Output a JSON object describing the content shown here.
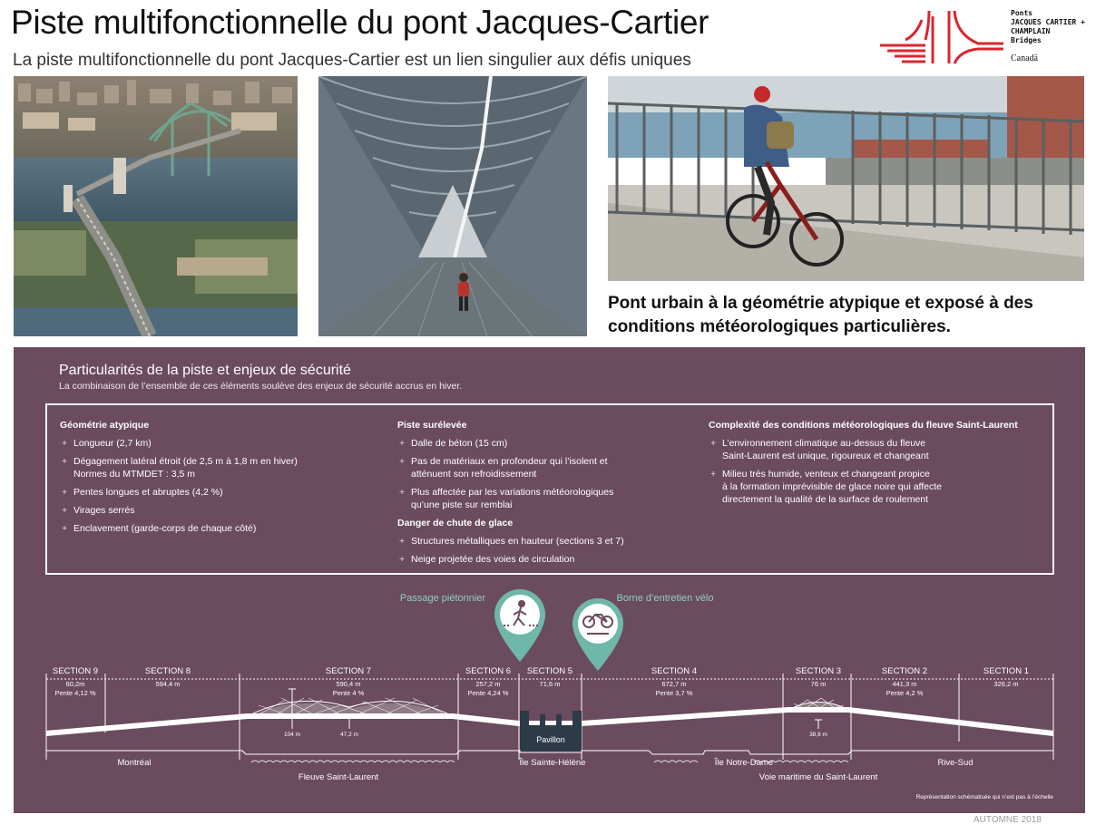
{
  "header": {
    "title": "Piste multifonctionnelle du pont Jacques-Cartier",
    "subtitle": "La piste multifonctionnelle du pont Jacques-Cartier est un lien singulier aux défis uniques"
  },
  "logo": {
    "line1": "Ponts",
    "line2": "JACQUES CARTIER +",
    "line3": "CHAMPLAIN",
    "line4": "Bridges",
    "canada": "Canadä",
    "color": "#d9262e"
  },
  "photos": [
    {
      "name": "aerial-bridge-photo"
    },
    {
      "name": "covered-walkway-photo"
    },
    {
      "name": "cyclist-photo"
    }
  ],
  "caption": "Pont urbain à la géométrie atypique et exposé à des conditions météorologiques particulières.",
  "panel": {
    "title": "Particularités de la piste et enjeux de sécurité",
    "subtitle": "La combinaison de l’ensemble de ces éléments soulève des enjeux de sécurité accrus en hiver.",
    "background": "#6b4b5e",
    "columns": [
      {
        "groups": [
          {
            "heading": "Géométrie atypique",
            "items": [
              "Longueur (2,7 km)",
              "Dégagement latéral étroit (de 2,5 m à 1,8 m en hiver)",
              "Pentes longues et abruptes (4,2 %)",
              "Virages serrés",
              "Enclavement (garde-corps de chaque côté)"
            ],
            "item_extra": {
              "1": "Normes du MTMDET : 3,5 m"
            }
          }
        ]
      },
      {
        "groups": [
          {
            "heading": "Piste surélevée",
            "items": [
              "Dalle de béton (15 cm)",
              "Pas de matériaux en profondeur qui l’isolent et",
              "Plus affectée par les variations météorologiques"
            ],
            "item_extra": {
              "1": "atténuent son refroidissement",
              "2": "qu’une piste sur remblai"
            }
          },
          {
            "heading": "Danger de chute de glace",
            "items": [
              "Structures métalliques en hauteur  (sections 3 et 7)",
              "Neige projetée des voies de circulation"
            ],
            "item_extra": {}
          }
        ]
      },
      {
        "groups": [
          {
            "heading": "Complexité des conditions météorologiques du fleuve Saint-Laurent",
            "items": [
              "L’environnement climatique au-dessus du fleuve",
              "Milieu très humide, venteux et changeant propice"
            ],
            "item_extra": {
              "0": "Saint-Laurent est unique, rigoureux et changeant",
              "1": "à la formation imprévisible de glace noire qui affecte"
            },
            "item_extra2": {
              "1": "directement la qualité de la surface de roulement"
            }
          }
        ]
      }
    ]
  },
  "diagram": {
    "markers": [
      {
        "label": "Passage piétonnier",
        "icon": "pedestrian-crossing-icon"
      },
      {
        "label": "Borne d’entretien vélo",
        "icon": "bicycle-repair-icon"
      }
    ],
    "marker_color": "#6fb7a8",
    "sections": [
      {
        "name": "SECTION 9",
        "length": "60,2m",
        "slope": "Pente 4,12 %"
      },
      {
        "name": "SECTION 8",
        "length": "594,4 m",
        "slope": ""
      },
      {
        "name": "SECTION 7",
        "length": "590,4 m",
        "slope": "Pente 4 %"
      },
      {
        "name": "SECTION 6",
        "length": "257,2 m",
        "slope": "Pente 4,24 %"
      },
      {
        "name": "SECTION 5",
        "length": "71,6 m",
        "slope": ""
      },
      {
        "name": "SECTION 4",
        "length": "672,7 m",
        "slope": "Pente 3,7 %"
      },
      {
        "name": "SECTION 3",
        "length": "76 m",
        "slope": ""
      },
      {
        "name": "SECTION 2",
        "length": "441,3 m",
        "slope": "Pente 4,2 %"
      },
      {
        "name": "SECTION 1",
        "length": "326,2 m",
        "slope": ""
      }
    ],
    "heights": [
      "104 m",
      "47,2 m",
      "38,6 m"
    ],
    "pavilion": "Pavillon",
    "places": [
      "Montréal",
      "Fleuve Saint-Laurent",
      "Île Sainte-Hélène",
      "Île Notre-Dame",
      "Voie maritime du Saint-Laurent",
      "Rive-Sud"
    ],
    "note": "Représentation schématisée qui n’est pas à l’échelle"
  },
  "footer": "AUTOMNE 2018"
}
